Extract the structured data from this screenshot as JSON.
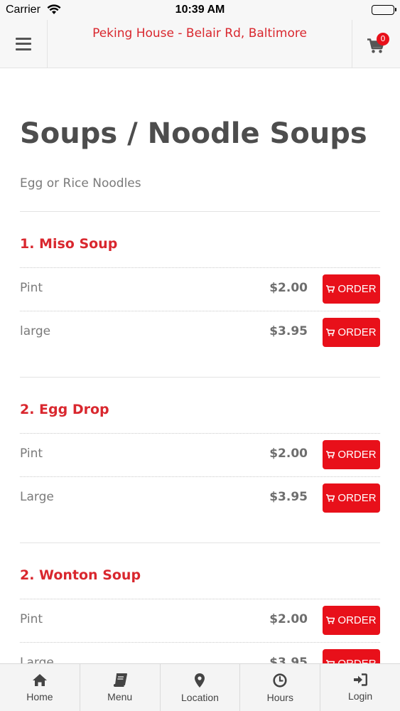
{
  "status_bar": {
    "carrier": "Carrier",
    "time": "10:39 AM"
  },
  "header": {
    "title": "Peking House - Belair Rd, Baltimore",
    "cart_count": "0",
    "brand_color": "#d9272e"
  },
  "section": {
    "title": "Soups / Noodle Soups",
    "description": "Egg or Rice Noodles"
  },
  "items": [
    {
      "name": "1. Miso Soup",
      "options": [
        {
          "size": "Pint",
          "price": "$2.00",
          "button": "ORDER"
        },
        {
          "size": "large",
          "price": "$3.95",
          "button": "ORDER"
        }
      ]
    },
    {
      "name": "2. Egg Drop",
      "options": [
        {
          "size": "Pint",
          "price": "$2.00",
          "button": "ORDER"
        },
        {
          "size": "Large",
          "price": "$3.95",
          "button": "ORDER"
        }
      ]
    },
    {
      "name": "2. Wonton Soup",
      "options": [
        {
          "size": "Pint",
          "price": "$2.00",
          "button": "ORDER"
        },
        {
          "size": "Large",
          "price": "$3.95",
          "button": "ORDER"
        }
      ]
    }
  ],
  "tabs": [
    {
      "label": "Home",
      "icon": "home-icon"
    },
    {
      "label": "Menu",
      "icon": "book-icon"
    },
    {
      "label": "Location",
      "icon": "map-pin-icon"
    },
    {
      "label": "Hours",
      "icon": "clock-icon"
    },
    {
      "label": "Login",
      "icon": "sign-in-icon"
    }
  ],
  "colors": {
    "accent": "#d9272e",
    "order_button": "#e8101a",
    "title_text": "#4d4d4d"
  }
}
